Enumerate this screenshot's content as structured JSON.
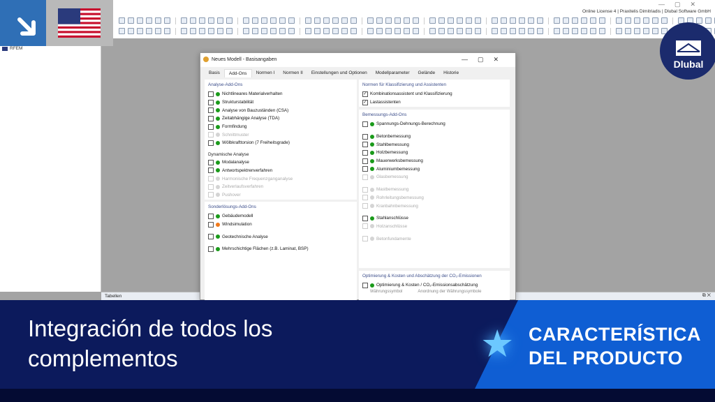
{
  "app": {
    "license": "Online License 4 | Praxitelis Dimitriadis | Dlubal Software GmbH",
    "navigator_root": "RFEM",
    "tables_label": "Tabellen",
    "logo": "Dlubal"
  },
  "dialog": {
    "title": "Neues Modell - Basisangaben",
    "tabs": [
      "Basis",
      "Add-Ons",
      "Normen I",
      "Normen II",
      "Einstellungen und Optionen",
      "Modellparameter",
      "Gelände",
      "Historie"
    ],
    "active_tab": "Add-Ons",
    "colors": {
      "green": "#1a9a1a",
      "orange": "#f07a1a",
      "disabled": "#d4d4d4"
    },
    "left": [
      {
        "title": "Analyse-Add-Ons",
        "groups": [
          {
            "items": [
              {
                "label": "Nichtlineares Materialverhalten",
                "status": "green",
                "checked": false
              },
              {
                "label": "Strukturstabilität",
                "status": "green",
                "checked": false
              },
              {
                "label": "Analyse von Bauzuständen (CSA)",
                "status": "green",
                "checked": false
              },
              {
                "label": "Zeitabhängige Analyse (TDA)",
                "status": "green",
                "checked": false
              },
              {
                "label": "Formfindung",
                "status": "green",
                "checked": false
              },
              {
                "label": "Schnittmuster",
                "status": "disabled",
                "checked": false
              },
              {
                "label": "Wölbkrafttorsion (7 Freiheitsgrade)",
                "status": "green",
                "checked": false
              }
            ]
          },
          {
            "subtitle": "Dynamische Analyse",
            "items": [
              {
                "label": "Modalanalyse",
                "status": "green",
                "checked": false
              },
              {
                "label": "Antwortspektrenverfahren",
                "status": "green",
                "checked": false
              },
              {
                "label": "Harmonische Frequenzganganalyse",
                "status": "disabled",
                "checked": false
              },
              {
                "label": "Zeitverlaufsverfahren",
                "status": "disabled",
                "checked": false
              },
              {
                "label": "Pushover",
                "status": "disabled",
                "checked": false
              }
            ]
          }
        ]
      },
      {
        "title": "Sonderlösungs-Add-Ons",
        "groups": [
          {
            "items": [
              {
                "label": "Gebäudemodell",
                "status": "green",
                "checked": false
              },
              {
                "label": "Windsimulation",
                "status": "orange",
                "checked": false
              }
            ]
          },
          {
            "items": [
              {
                "label": "Geotechnische Analyse",
                "status": "green",
                "checked": false
              }
            ]
          },
          {
            "items": [
              {
                "label": "Mehrschichtige Flächen (z.B. Laminat, BSP)",
                "status": "green",
                "checked": false
              }
            ]
          }
        ]
      }
    ],
    "right": [
      {
        "title": "Normen für Klassifizierung und Assistenten",
        "groups": [
          {
            "items": [
              {
                "label": "Kombinationsassistent und Klassifizierung",
                "status": "none",
                "checked": true
              },
              {
                "label": "Lastassistenten",
                "status": "none",
                "checked": true
              }
            ]
          }
        ]
      },
      {
        "title": "Bemessungs-Add-Ons",
        "groups": [
          {
            "items": [
              {
                "label": "Spannungs-Dehnungs-Berechnung",
                "status": "green",
                "checked": false
              }
            ]
          },
          {
            "items": [
              {
                "label": "Betonbemessung",
                "status": "green",
                "checked": false
              },
              {
                "label": "Stahlbemessung",
                "status": "green",
                "checked": false
              },
              {
                "label": "Holzbemessung",
                "status": "green",
                "checked": false
              },
              {
                "label": "Mauerwerksbemessung",
                "status": "green",
                "checked": false
              },
              {
                "label": "Aluminiumbemessung",
                "status": "green",
                "checked": false
              },
              {
                "label": "Glasbemessung",
                "status": "disabled",
                "checked": false
              }
            ]
          },
          {
            "items": [
              {
                "label": "Mastbemessung",
                "status": "disabled",
                "checked": false
              },
              {
                "label": "Rohrleitungsbemessung",
                "status": "disabled",
                "checked": false
              },
              {
                "label": "Kranbahnbemessung",
                "status": "disabled",
                "checked": false
              }
            ]
          },
          {
            "items": [
              {
                "label": "Stahlanschlüsse",
                "status": "green",
                "checked": false
              },
              {
                "label": "Holzanschlüsse",
                "status": "disabled",
                "checked": false
              }
            ]
          },
          {
            "items": [
              {
                "label": "Betonfundamente",
                "status": "disabled",
                "checked": false
              }
            ]
          }
        ]
      },
      {
        "title": "Optimierung & Kosten und Abschätzung der CO₂-Emissionen",
        "groups": [
          {
            "items": [
              {
                "label": "Optimierung & Kosten / CO₂-Emissionsabschätzung",
                "status": "green",
                "checked": false
              }
            ]
          }
        ],
        "fields": [
          "Währungssymbol",
          "Anordnung der Währungssymbole"
        ]
      }
    ]
  },
  "banner": {
    "headline": "Integración de todos los complementos",
    "feature_line1": "CARACTERÍSTICA",
    "feature_line2": "DEL PRODUCTO"
  }
}
